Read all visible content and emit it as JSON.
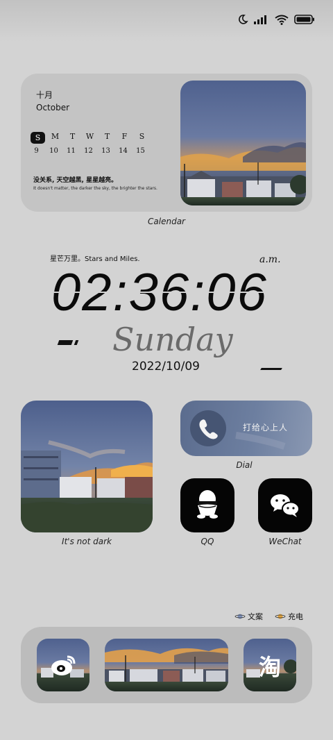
{
  "status_bar": {
    "icons": [
      "moon-icon",
      "signal-icon",
      "wifi-icon",
      "battery-icon"
    ]
  },
  "calendar_widget": {
    "month_zh": "十月",
    "month_en": "October",
    "weekdays": [
      "S",
      "M",
      "T",
      "W",
      "T",
      "F",
      "S"
    ],
    "dates": [
      "9",
      "10",
      "11",
      "12",
      "13",
      "14",
      "15"
    ],
    "active_day_index": 0,
    "quote_zh": "没关系, 天空越黑, 星星越亮。",
    "quote_en": "It doesn't matter, the darker the sky, the brighter the stars.",
    "caption": "Calendar"
  },
  "clock_widget": {
    "slogan": "星芒万里。Stars and Miles.",
    "period": "a.m.",
    "time": "02:36:06",
    "weekday": "Sunday",
    "date": "2022/10/09"
  },
  "photo_widget": {
    "caption": "It's not dark"
  },
  "dial_widget": {
    "label": "打给心上人",
    "caption": "Dial"
  },
  "apps": {
    "qq": {
      "label": "QQ",
      "icon": "qq-penguin-icon"
    },
    "wechat": {
      "label": "WeChat",
      "icon": "wechat-icon"
    }
  },
  "legend": {
    "item1": "文案",
    "item2": "充电",
    "item1_color": "#7d8fb8",
    "item2_color": "#e0a23c"
  },
  "dock": {
    "items": [
      "weibo-icon",
      "sunset-photo",
      "taobao-icon"
    ],
    "taobao_glyph": "淘"
  },
  "colors": {
    "background": "#d3d3d3",
    "widget_bg": "#c4c4c4",
    "dock_bg": "#bcbcbc",
    "dial_blue": "#5b6c8e"
  }
}
